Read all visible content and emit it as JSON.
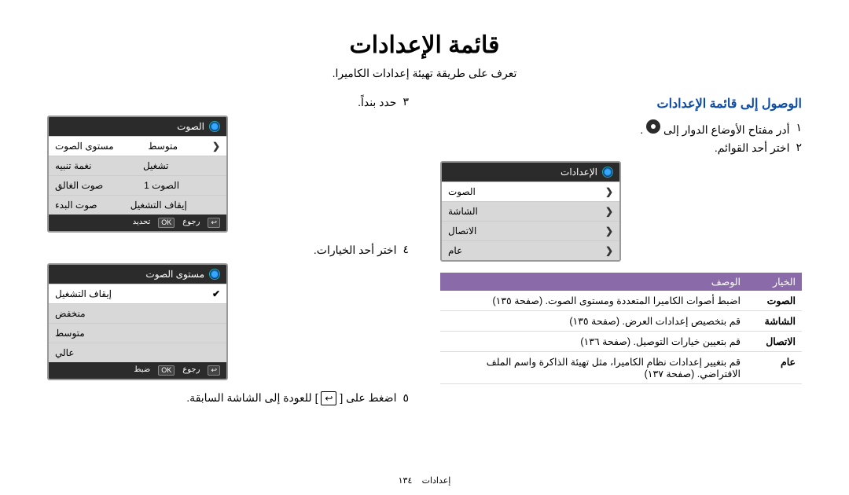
{
  "title": "قائمة الإعدادات",
  "subtitle": "تعرف على طريقة تهيئة إعدادات الكاميرا.",
  "right": {
    "heading": "الوصول إلى قائمة الإعدادات",
    "step1_num": "١",
    "step1_text_a": "أدر مفتاح الأوضاع الدوار إلى",
    "step1_text_b": ".",
    "step2_num": "٢",
    "step2_text": "اختر أحد القوائم.",
    "panel_title": "الإعدادات",
    "panel_items": [
      "الصوت",
      "الشاشة",
      "الاتصال",
      "عام"
    ],
    "table_header_opt": "الخيار",
    "table_header_desc": "الوصف",
    "rows": [
      {
        "opt": "الصوت",
        "desc": "اضبط أصوات الكاميرا المتعددة ومستوى الصوت. (صفحة ١٣٥)"
      },
      {
        "opt": "الشاشة",
        "desc": "قم بتخصيص إعدادات العرض. (صفحة ١٣٥)"
      },
      {
        "opt": "الاتصال",
        "desc": "قم بتعيين خيارات التوصيل. (صفحة ١٣٦)"
      },
      {
        "opt": "عام",
        "desc": "قم بتغيير إعدادات نظام الكاميرا، مثل تهيئة الذاكرة واسم الملف الافتراضي. (صفحة ١٣٧)"
      }
    ]
  },
  "left": {
    "step3_num": "٣",
    "step3_text": "حدد بنداً.",
    "panel1_title": "الصوت",
    "panel1_rows": [
      {
        "r": "مستوى الصوت",
        "l": "متوسط"
      },
      {
        "r": "نغمة تنبيه",
        "l": "تشغيل"
      },
      {
        "r": "صوت الغالق",
        "l": "الصوت 1"
      },
      {
        "r": "صوت البدء",
        "l": "إيقاف التشغيل"
      }
    ],
    "panel1_footer": {
      "ok": "OK",
      "ok_label": "تحديد",
      "back": "↩",
      "back_label": "رجوع"
    },
    "step4_num": "٤",
    "step4_text": "اختر أحد الخيارات.",
    "panel2_title": "مستوى الصوت",
    "panel2_rows": [
      {
        "label": "إيقاف التشغيل",
        "selected": true
      },
      {
        "label": "منخفض"
      },
      {
        "label": "متوسط"
      },
      {
        "label": "عالي"
      }
    ],
    "panel2_footer": {
      "ok": "OK",
      "ok_label": "ضبط",
      "back": "↩",
      "back_label": "رجوع"
    },
    "step5_num": "٥",
    "step5_text_a": "اضغط على [",
    "step5_text_b": "] للعودة إلى الشاشة السابقة.",
    "back_glyph": "↩"
  },
  "footer_text": "إعدادات",
  "footer_page": "١٣٤"
}
